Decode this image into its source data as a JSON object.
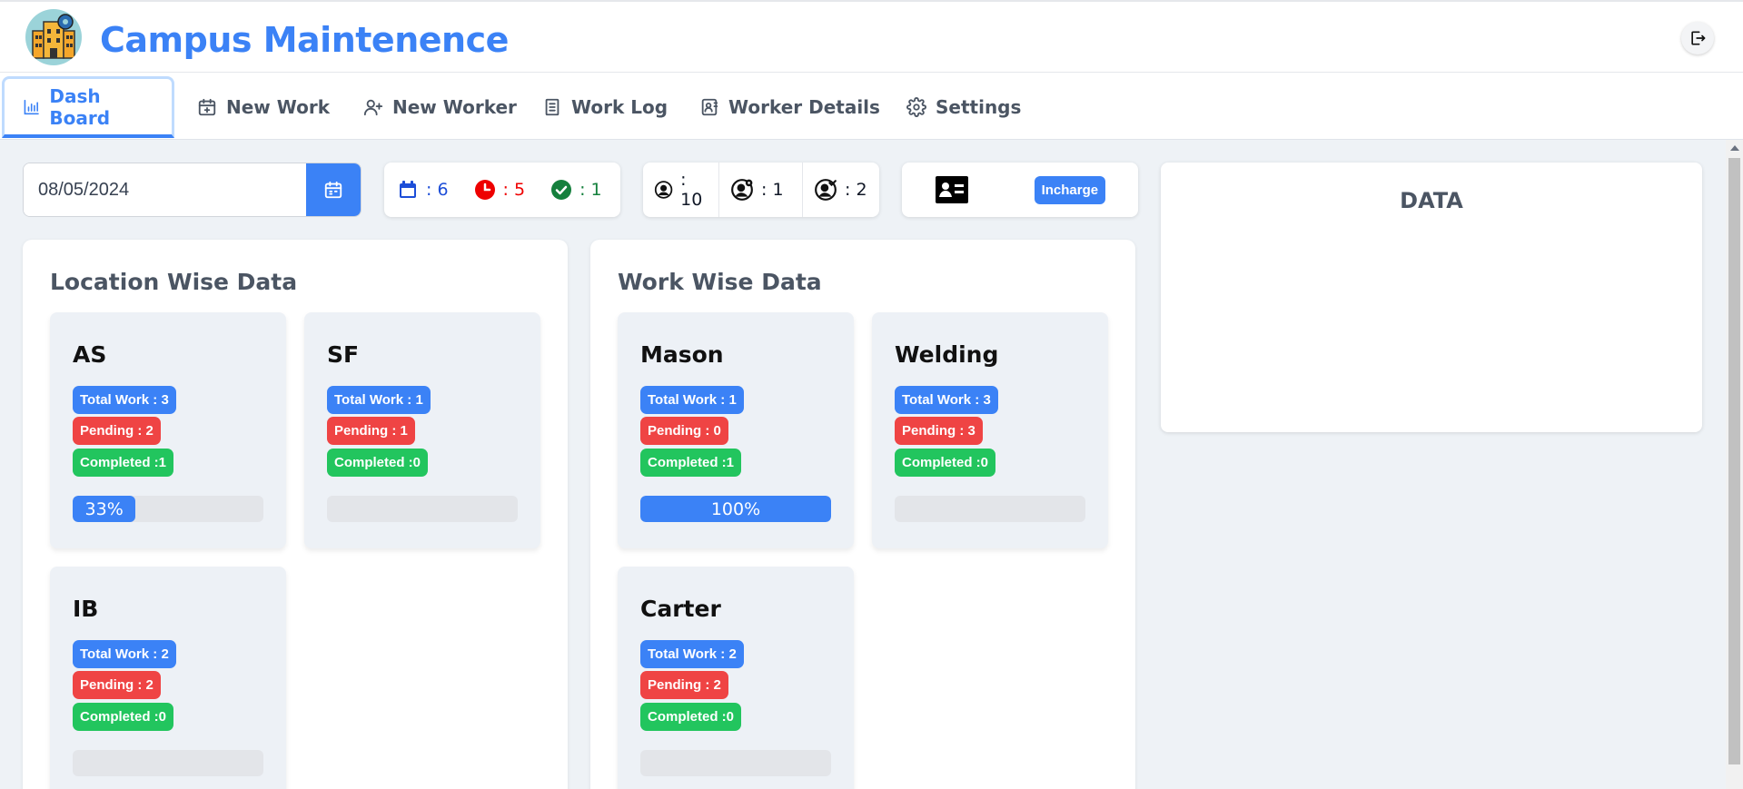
{
  "app": {
    "title": "Campus Maintenence"
  },
  "nav": {
    "tabs": [
      {
        "label": "Dash Board",
        "icon": "bar-chart-icon"
      },
      {
        "label": "New Work",
        "icon": "calendar-plus-icon"
      },
      {
        "label": "New Worker",
        "icon": "user-plus-icon"
      },
      {
        "label": "Work Log",
        "icon": "document-icon"
      },
      {
        "label": "Worker Details",
        "icon": "contact-card-icon"
      },
      {
        "label": "Settings",
        "icon": "gear-icon"
      }
    ]
  },
  "date": {
    "value": "08/05/2024"
  },
  "work_stats": {
    "total": ": 6",
    "pending": ": 5",
    "completed": ": 1"
  },
  "worker_stats": {
    "all": ": 10",
    "busy": ": 1",
    "available": ": 2"
  },
  "incharge": {
    "label": "Incharge"
  },
  "data_panel": {
    "title": "DATA"
  },
  "location_panel": {
    "title": "Location Wise Data",
    "cards": [
      {
        "name": "AS",
        "total": "Total Work : 3",
        "pending": "Pending : 2",
        "completed": "Completed :1",
        "progress": 33,
        "progress_label": "33%"
      },
      {
        "name": "SF",
        "total": "Total Work : 1",
        "pending": "Pending : 1",
        "completed": "Completed :0",
        "progress": 0,
        "progress_label": ""
      },
      {
        "name": "IB",
        "total": "Total Work : 2",
        "pending": "Pending : 2",
        "completed": "Completed :0",
        "progress": 0,
        "progress_label": ""
      }
    ]
  },
  "work_panel": {
    "title": "Work Wise Data",
    "cards": [
      {
        "name": "Mason",
        "total": "Total Work : 1",
        "pending": "Pending : 0",
        "completed": "Completed :1",
        "progress": 100,
        "progress_label": "100%"
      },
      {
        "name": "Welding",
        "total": "Total Work : 3",
        "pending": "Pending : 3",
        "completed": "Completed :0",
        "progress": 0,
        "progress_label": ""
      },
      {
        "name": "Carter",
        "total": "Total Work : 2",
        "pending": "Pending : 2",
        "completed": "Completed :0",
        "progress": 0,
        "progress_label": ""
      }
    ]
  },
  "colors": {
    "accent": "#3b82f6",
    "pending": "#ef4444",
    "completed": "#22c55e",
    "total_blue": "#1d4ed8"
  }
}
